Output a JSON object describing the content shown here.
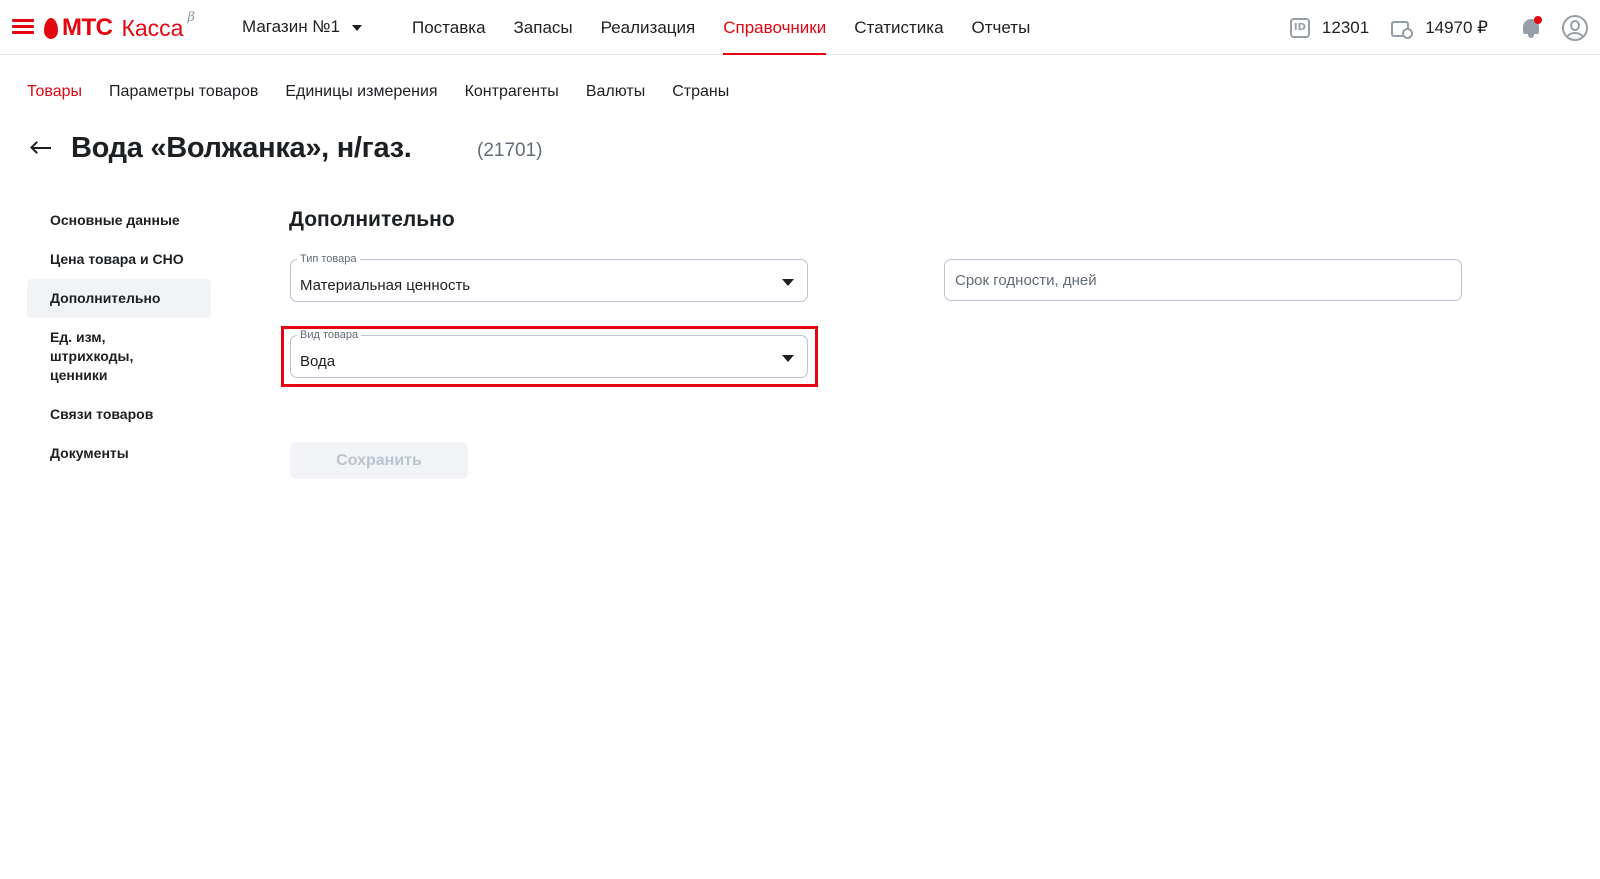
{
  "header": {
    "logo_mts": "МТС",
    "logo_kassa": "Касса",
    "logo_beta": "β",
    "store_name": "Магазин №1",
    "nav": [
      {
        "label": "Поставка"
      },
      {
        "label": "Запасы"
      },
      {
        "label": "Реализация"
      },
      {
        "label": "Справочники",
        "active": true
      },
      {
        "label": "Статистика"
      },
      {
        "label": "Отчеты"
      }
    ],
    "id_icon_text": "ID",
    "id_value": "12301",
    "balance": "14970 ₽",
    "has_notification": true,
    "accent_color": "#e30611"
  },
  "subnav": [
    {
      "label": "Товары",
      "active": true
    },
    {
      "label": "Параметры товаров"
    },
    {
      "label": "Единицы измерения"
    },
    {
      "label": "Контрагенты"
    },
    {
      "label": "Валюты"
    },
    {
      "label": "Страны"
    }
  ],
  "page": {
    "title": "Вода «Волжанка», н/газ.",
    "code": "(21701)"
  },
  "sidemenu": [
    {
      "label": "Основные данные"
    },
    {
      "label": "Цена товара и СНО"
    },
    {
      "label": "Дополнительно",
      "active": true
    },
    {
      "label": "Ед. изм, штрихкоды, ценники"
    },
    {
      "label": "Связи товаров"
    },
    {
      "label": "Документы"
    }
  ],
  "form": {
    "section_title": "Дополнительно",
    "product_type": {
      "label": "Тип товара",
      "value": "Материальная ценность"
    },
    "product_kind": {
      "label": "Вид товара",
      "value": "Вода"
    },
    "shelf_life": {
      "placeholder": "Срок годности, дней",
      "value": ""
    },
    "save_label": "Сохранить",
    "save_enabled": false
  },
  "icons": {
    "menu": "hamburger-menu-icon",
    "store_dropdown": "chevron-down-icon",
    "id": "id-card-icon",
    "balance": "wallet-icon",
    "notifications": "bell-icon",
    "profile": "user-avatar-icon",
    "back": "arrow-left-icon"
  }
}
